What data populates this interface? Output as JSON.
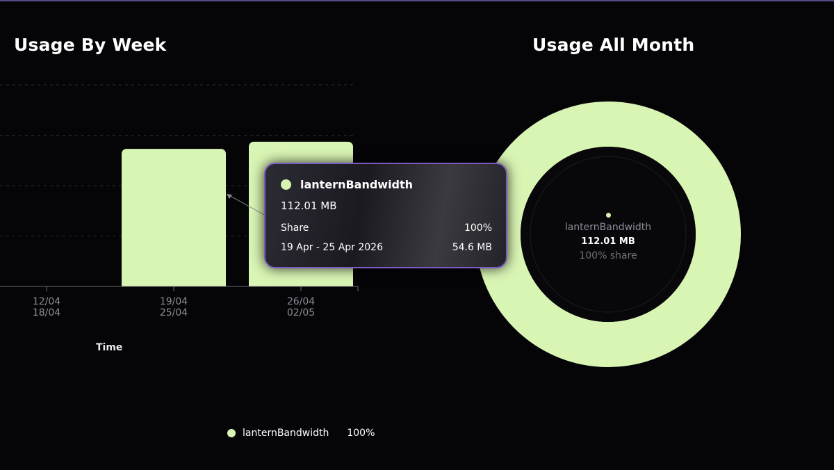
{
  "colors": {
    "series": "#d9f5b4",
    "background": "#050508",
    "accent": "#7a5ac0"
  },
  "week_panel": {
    "title": "Usage By Week"
  },
  "month_panel": {
    "title": "Usage All Month"
  },
  "chart_data": [
    {
      "type": "bar",
      "title": "Usage By Week",
      "xlabel": "Time",
      "ylabel": "",
      "categories": [
        {
          "start": "12/04",
          "end": "18/04"
        },
        {
          "start": "19/04",
          "end": "25/04"
        },
        {
          "start": "26/04",
          "end": "02/05"
        }
      ],
      "series": [
        {
          "name": "lanternBandwidth",
          "values_mb": [
            0,
            54.6,
            57.41
          ]
        }
      ],
      "ylim": [
        0,
        80
      ],
      "grid": true,
      "legend": "bottom-center",
      "legend_entries": [
        {
          "name": "lanternBandwidth",
          "share": "100%"
        }
      ]
    },
    {
      "type": "pie",
      "style": "donut",
      "title": "Usage All Month",
      "slices": [
        {
          "name": "lanternBandwidth",
          "value_mb": 112.01,
          "share": "100%"
        }
      ],
      "center": {
        "name": "lanternBandwidth",
        "value": "112.01 MB",
        "share": "100% share"
      }
    }
  ],
  "tooltip": {
    "series_name": "lanternBandwidth",
    "total": "112.01 MB",
    "share_label": "Share",
    "share_value": "100%",
    "period_label": "19 Apr - 25 Apr 2026",
    "period_value": "54.6 MB"
  }
}
